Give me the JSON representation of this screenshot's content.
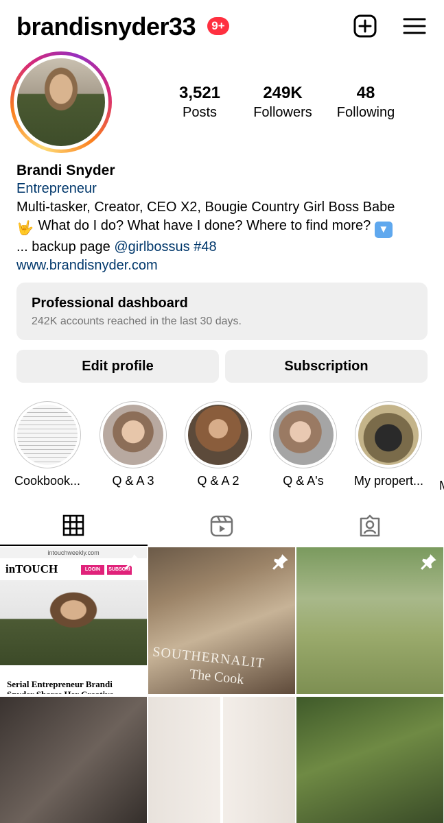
{
  "header": {
    "username": "brandisnyder33",
    "notification_badge": "9+",
    "new_post_icon": "add-square-icon",
    "menu_icon": "hamburger-menu-icon"
  },
  "stats": {
    "posts": {
      "value": "3,521",
      "label": "Posts"
    },
    "followers": {
      "value": "249K",
      "label": "Followers"
    },
    "following": {
      "value": "48",
      "label": "Following"
    }
  },
  "bio": {
    "name": "Brandi Snyder",
    "category": "Entrepreneur",
    "line1": "Multi-tasker, Creator, CEO X2, Bougie Country Girl Boss Babe",
    "line2_text": " What do I do? What have I done? Where to find more? ",
    "line3_prefix": "... backup page ",
    "line3_mention": "@girlbossus",
    "line3_hashtag": "#48",
    "website": "www.brandisnyder.com"
  },
  "dashboard": {
    "title": "Professional dashboard",
    "subtitle": "242K accounts reached in the last 30 days."
  },
  "buttons": {
    "edit_profile": "Edit profile",
    "subscription": "Subscription"
  },
  "highlights": [
    {
      "label": "Cookbook..."
    },
    {
      "label": "Q & A 3"
    },
    {
      "label": "Q & A 2"
    },
    {
      "label": "Q & A's"
    },
    {
      "label": "My propert..."
    },
    {
      "label": "M"
    }
  ],
  "tabs": [
    {
      "icon": "grid-icon",
      "selected": true
    },
    {
      "icon": "reels-icon",
      "selected": false
    },
    {
      "icon": "tagged-icon",
      "selected": false
    }
  ],
  "grid": {
    "post1": {
      "browser_bar": "intouchweekly.com",
      "logo": "inTOUCH",
      "login": "LOGIN",
      "subscribe": "SUBSCRI",
      "headline": "Serial Entrepreneur Brandi Snyder Shares Her Creative Process"
    },
    "post2": {
      "text1": "SOUTHERNALIT",
      "text2": "The Cook"
    }
  },
  "colors": {
    "link": "#00376b",
    "badge": "#ff3040",
    "button_bg": "#efefef",
    "secondary_text": "#737373"
  }
}
